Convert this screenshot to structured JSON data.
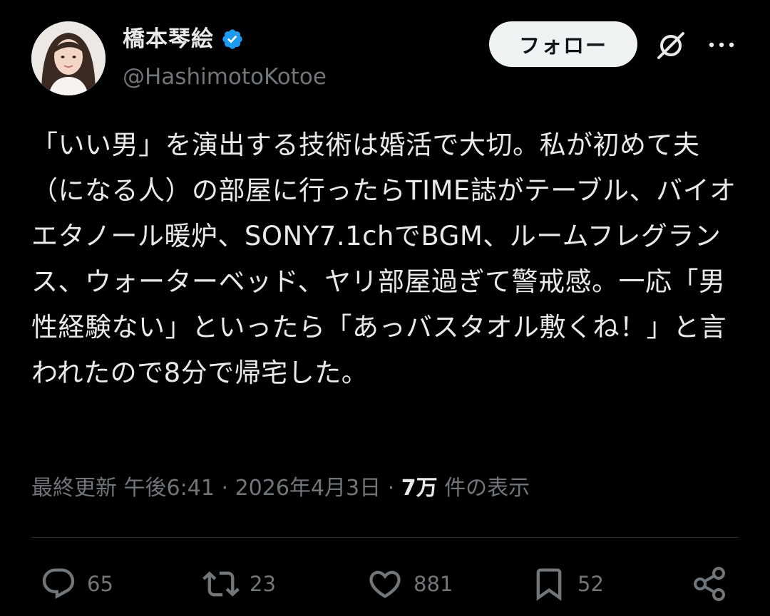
{
  "user": {
    "display_name": "橋本琴絵",
    "handle": "@HashimotoKotoe",
    "verified": true,
    "verified_color": "#1d9bf0"
  },
  "header": {
    "follow_label": "フォロー",
    "grok_icon": "grok-icon",
    "more_icon": "more-icon"
  },
  "tweet": {
    "text": "「いい男」を演出する技術は婚活で大切。私が初めて夫（になる人）の部屋に行ったらTIME誌がテーブル、バイオエタノール暖炉、SONY7.1chでBGM、ルームフレグランス、ウォーターベッド、ヤリ部屋過ぎて警戒感。一応「男性経験ない」といったら「あっバスタオル敷くね！」と言われたので8分で帰宅した。"
  },
  "meta": {
    "updated_label": "最終更新",
    "time": "午後6:41",
    "separator": "·",
    "date": "2026年4月3日",
    "views_count": "7万",
    "views_label": "件の表示"
  },
  "actions": {
    "replies": "65",
    "reposts": "23",
    "likes": "881",
    "bookmarks": "52"
  },
  "colors": {
    "background": "#000000",
    "text": "#e7e9ea",
    "secondary": "#71767b",
    "divider": "#2f3336",
    "follow_bg": "#eff3f4"
  }
}
